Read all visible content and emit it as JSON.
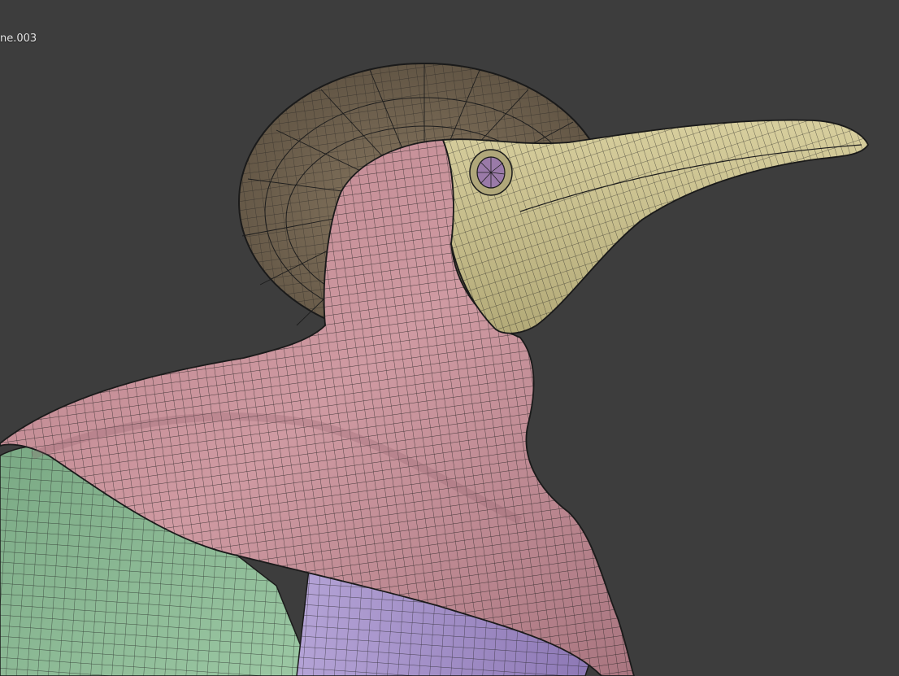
{
  "viewport": {
    "object_name": "ne.003",
    "background_color": "#3d3d3d"
  },
  "materials": {
    "hat": "#7a6a55",
    "mask": "#c9c190",
    "hood": "#c18c94",
    "eye": "#9a7aa8",
    "robe_left": "#88b892",
    "robe_right": "#a995c9",
    "wire": "#1d1d1d"
  }
}
